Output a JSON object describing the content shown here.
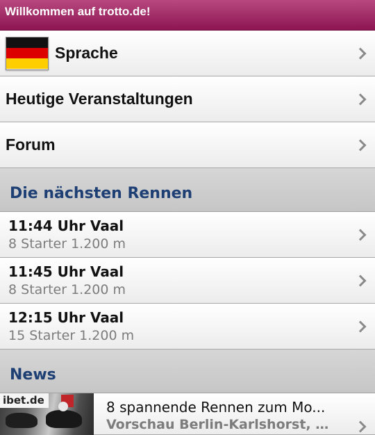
{
  "header": {
    "title": "Willkommen auf trotto.de!"
  },
  "menu": [
    {
      "label": "Sprache",
      "flag": "germany-flag"
    },
    {
      "label": "Heutige Veranstaltungen"
    },
    {
      "label": "Forum"
    }
  ],
  "races_section": {
    "title": "Die nächsten Rennen",
    "items": [
      {
        "title": "11:44 Uhr Vaal",
        "subtitle": "8 Starter 1.200 m"
      },
      {
        "title": "11:45 Uhr Vaal",
        "subtitle": "8 Starter 1.200 m"
      },
      {
        "title": "12:15 Uhr Vaal",
        "subtitle": "15 Starter 1.200 m"
      }
    ]
  },
  "news_section": {
    "title": "News",
    "items": [
      {
        "thumb_brand": "ibet.de",
        "title": "8 spannende Rennen zum Mo...",
        "subtitle": "Vorschau Berlin-Karlshorst, 0..."
      }
    ]
  },
  "colors": {
    "header_gradient_top": "#b8487f",
    "header_gradient_bottom": "#8d1552",
    "section_title": "#1d3f74",
    "secondary_text": "#7c7c7c",
    "chevron": "#8a8a8a"
  },
  "icons": {
    "row_chevron": "chevron-right-icon"
  }
}
